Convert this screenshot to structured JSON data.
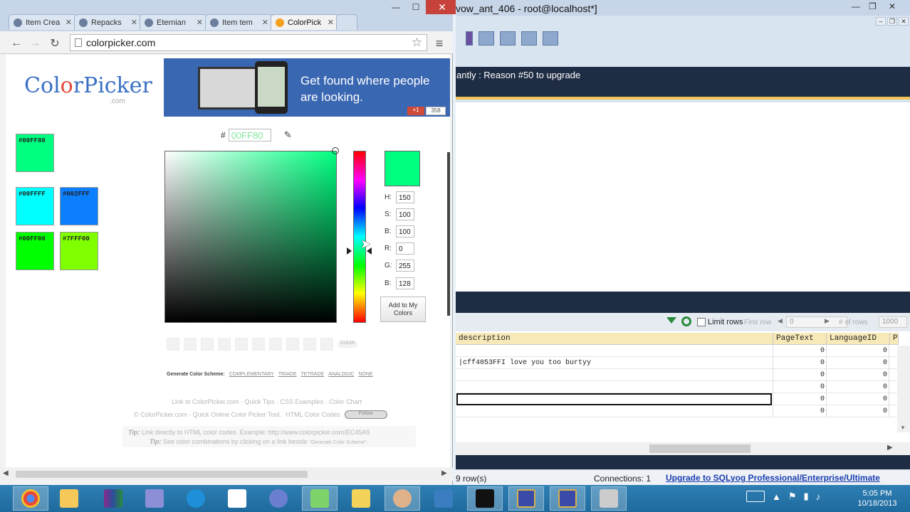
{
  "browser": {
    "tabs": [
      {
        "title": "Item Crea",
        "active": false
      },
      {
        "title": "Repacks",
        "active": false
      },
      {
        "title": "Eternian",
        "active": false
      },
      {
        "title": "Item tem",
        "active": false
      },
      {
        "title": "ColorPick",
        "active": true
      }
    ],
    "url": "colorpicker.com",
    "window_controls": {
      "minimize": "—",
      "maximize": "☐",
      "close": "✕"
    }
  },
  "colorpicker": {
    "logo": {
      "text": "ColorPicker",
      "sub": ".com"
    },
    "ad": {
      "headline": "Get found where people are looking.",
      "gplus": "+1",
      "count": "358"
    },
    "hex": {
      "hash": "#",
      "value": "00FF80"
    },
    "swatches": [
      {
        "label": "#00FF80",
        "color": "#00ff80"
      },
      {
        "label": "#00FFFF",
        "color": "#00ffff"
      },
      {
        "label": "#002FFF",
        "color": "#0c7fff"
      },
      {
        "label": "#00FF00",
        "color": "#00ff00"
      },
      {
        "label": "#7FFF00",
        "color": "#7fff00"
      }
    ],
    "preview_color": "#00ff80",
    "values": [
      {
        "label": "H:",
        "value": "150"
      },
      {
        "label": "S:",
        "value": "100"
      },
      {
        "label": "B:",
        "value": "100"
      },
      {
        "label": "R:",
        "value": "0"
      },
      {
        "label": "G:",
        "value": "255"
      },
      {
        "label": "B:",
        "value": "128"
      }
    ],
    "add_button": "Add to My Colors",
    "clear": "CLEAR",
    "scheme": {
      "label": "Generate Color Scheme:",
      "options": [
        "COMPLEMENTARY",
        "TRIADE",
        "TETRADE",
        "ANALOGIC",
        "NONE"
      ]
    },
    "footer_links": "Link to ColorPicker.com · Quick Tips · CSS Examples · Color Chart",
    "copyright": "© ColorPicker.com - Quick Online Color Picker Tool.",
    "html_codes": "HTML Color Codes",
    "follow": "Follow",
    "tips": [
      {
        "label": "Tip:",
        "text": "Link directly to HTML color codes.   Example: http://www.colorpicker.com/EC45A9"
      },
      {
        "label": "Tip:",
        "text": "See color combinations by clicking on a link beside",
        "small": "\"Generate Color Scheme\"."
      }
    ]
  },
  "sqlyog": {
    "title": "vow_ant_406 - root@localhost*]",
    "nag": "antly : Reason #50 to upgrade",
    "limit_rows": "Limit rows",
    "first_row": "First row",
    "first_row_value": "0",
    "num_rows": "# of rows",
    "num_rows_value": "1000",
    "columns": [
      "description",
      "PageText",
      "LanguageID",
      "P"
    ],
    "rows": [
      {
        "description": "",
        "PageText": "0",
        "LanguageID": "0"
      },
      {
        "description": "|cff4053FFI love you too burtyy",
        "PageText": "0",
        "LanguageID": "0"
      },
      {
        "description": "",
        "PageText": "0",
        "LanguageID": "0"
      },
      {
        "description": "",
        "PageText": "0",
        "LanguageID": "0"
      },
      {
        "description": "",
        "PageText": "0",
        "LanguageID": "0"
      },
      {
        "description": "",
        "PageText": "0",
        "LanguageID": "0"
      }
    ],
    "status": {
      "rows": "9 row(s)",
      "connections": "Connections: 1",
      "upgrade": "Upgrade to SQLyog Professional/Enterprise/Ultimate"
    }
  },
  "taskbar": {
    "apps": [
      "chrome-icon",
      "file-explorer-icon",
      "winrar-icon",
      "app-icon",
      "network-icon",
      "notepad-icon",
      "app-icon-2",
      "notepad-plus-icon",
      "character-icon",
      "visual-studio-icon",
      "cmd-icon",
      "warcraft-icon",
      "warcraft-icon-2",
      "sqlyog-icon"
    ],
    "time": "5:05 PM",
    "date": "10/18/2013"
  }
}
